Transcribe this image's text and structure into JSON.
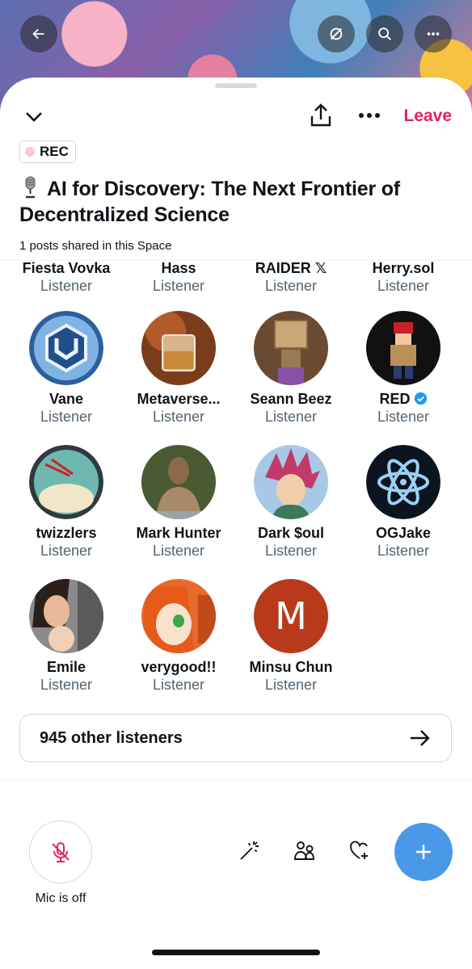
{
  "space": {
    "leave_label": "Leave",
    "rec_label": "REC",
    "title": "AI for Discovery: The Next Frontier of Decentralized Science",
    "posts_shared": "1 posts shared in this Space"
  },
  "participants_top_row": [
    {
      "name": "Fiesta Vovka",
      "role": "Listener"
    },
    {
      "name": "Hass",
      "role": "Listener"
    },
    {
      "name": "RAIDER 𝕏",
      "role": "Listener"
    },
    {
      "name": "Herry.sol",
      "role": "Listener"
    }
  ],
  "participants": [
    {
      "name": "Vane",
      "role": "Listener",
      "avatar": "blue-cube-logo"
    },
    {
      "name": "Metaverse...",
      "role": "Listener",
      "avatar": "whisky-glass-photo"
    },
    {
      "name": "Seann Beez",
      "role": "Listener",
      "avatar": "cardboard-robot-photo"
    },
    {
      "name": "RED",
      "role": "Listener",
      "avatar": "pixel-character",
      "verified": true
    },
    {
      "name": "twizzlers",
      "role": "Listener",
      "avatar": "cartoon-creature"
    },
    {
      "name": "Mark Hunter",
      "role": "Listener",
      "avatar": "bronze-statue-photo"
    },
    {
      "name": "Dark $oul",
      "role": "Listener",
      "avatar": "anime-spiky-hair"
    },
    {
      "name": "OGJake",
      "role": "Listener",
      "avatar": "atom-logo"
    },
    {
      "name": "Emile",
      "role": "Listener",
      "avatar": "family-photo"
    },
    {
      "name": "verygood!!",
      "role": "Listener",
      "avatar": "anime-girl-orange"
    },
    {
      "name": "Minsu Chun",
      "role": "Listener",
      "avatar": "letter-m",
      "avatar_letter": "M"
    }
  ],
  "other_listeners": "945 other listeners",
  "controls": {
    "mic_label": "Mic is off"
  },
  "colors": {
    "leave": "#e0245e",
    "fab": "#4a99e9",
    "verified": "#1d9bf0",
    "minsu_avatar": "#b83a1b"
  }
}
